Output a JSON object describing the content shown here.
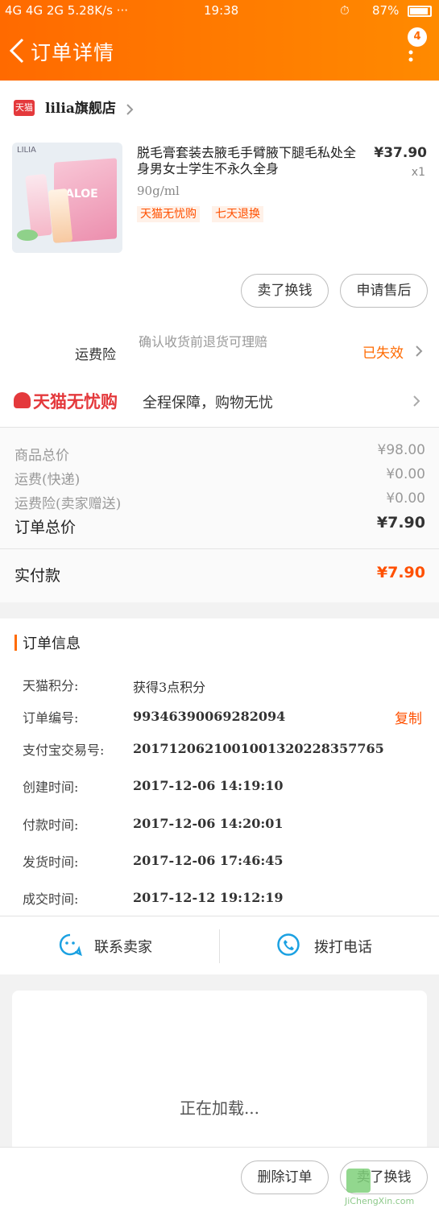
{
  "status_bar": {
    "left": "4G 4G 2G 5.28K/s ···",
    "time": "19:38",
    "battery": "87%"
  },
  "header": {
    "title": "订单详情",
    "badge_count": "4"
  },
  "shop": {
    "logo_text": "天猫",
    "name": "lilia旗舰店"
  },
  "product": {
    "brand": "LILIA",
    "title": "脱毛膏套装去腋毛手臂腋下腿毛私处全身男女士学生不永久全身",
    "spec": "90g/ml",
    "price": "¥37.90",
    "qty": "x1",
    "tags": [
      "天猫无忧购",
      "七天退换"
    ]
  },
  "actions": {
    "sell_again": "卖了换钱",
    "after_sale": "申请售后"
  },
  "insurance": {
    "label": "运费险",
    "desc": "确认收货前退货可理赔",
    "status": "已失效"
  },
  "tmall_worry_free": {
    "brand": "天猫无忧购",
    "desc": "全程保障，购物无忧"
  },
  "price_summary": {
    "goods_label": "商品总价",
    "goods_value": "¥98.00",
    "shipping_label": "运费(快递)",
    "shipping_value": "¥0.00",
    "ins_label": "运费险(卖家赠送)",
    "ins_value": "¥0.00",
    "total_label": "订单总价",
    "total_value": "¥7.90",
    "paid_label": "实付款",
    "paid_value": "¥7.90"
  },
  "order_info": {
    "section_title": "订单信息",
    "points_label": "天猫积分:",
    "points_value": "获得3点积分",
    "order_no_label": "订单编号:",
    "order_no_value": "99346390069282094",
    "copy": "复制",
    "alipay_label": "支付宝交易号:",
    "alipay_value": "2017120621001001320228357765",
    "created_label": "创建时间:",
    "created_value": "2017-12-06 14:19:10",
    "paid_label": "付款时间:",
    "paid_value": "2017-12-06 14:20:01",
    "shipped_label": "发货时间:",
    "shipped_value": "2017-12-06 17:46:45",
    "done_label": "成交时间:",
    "done_value": "2017-12-12 19:12:19"
  },
  "contact": {
    "seller": "联系卖家",
    "call": "拨打电话"
  },
  "loading": "正在加载...",
  "bottom_bar": {
    "delete": "删除订单",
    "sell_again": "卖了换钱"
  },
  "watermark": "JiChengXin.com",
  "colors": {
    "accent": "#ff6a00",
    "price_red": "#ff5000",
    "blue_icon": "#1ba1e2"
  }
}
